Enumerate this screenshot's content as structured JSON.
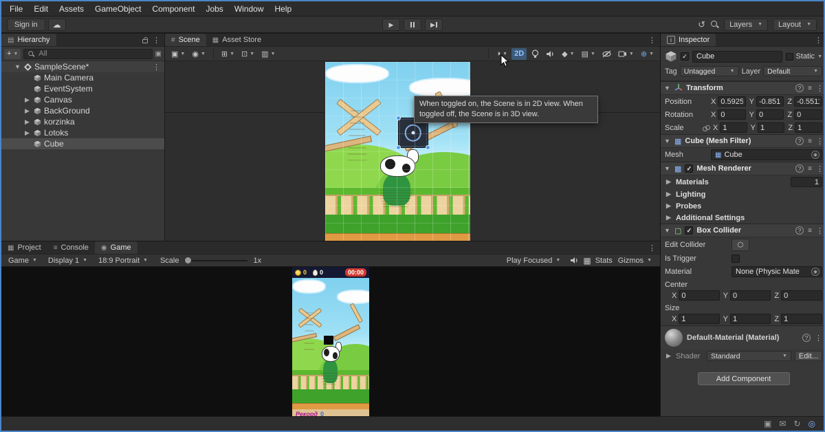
{
  "menu": {
    "items": [
      "File",
      "Edit",
      "Assets",
      "GameObject",
      "Component",
      "Jobs",
      "Window",
      "Help"
    ]
  },
  "toolbar": {
    "sign_in": "Sign in",
    "layers": "Layers",
    "layout": "Layout"
  },
  "hierarchy": {
    "title": "Hierarchy",
    "search_placeholder": "All",
    "scene_item": {
      "label": "SampleScene*"
    },
    "items": [
      {
        "label": "Main Camera"
      },
      {
        "label": "EventSystem"
      },
      {
        "label": "Canvas"
      },
      {
        "label": "BackGround"
      },
      {
        "label": "korzinka"
      },
      {
        "label": "Lotoks"
      },
      {
        "label": "Cube"
      }
    ]
  },
  "scene_panel": {
    "tabs": [
      {
        "label": "Scene"
      },
      {
        "label": "Asset Store"
      }
    ],
    "toggle_2d": "2D",
    "tooltip": {
      "line1": "When toggled on, the Scene is in 2D view. When",
      "line2": "toggled off, the Scene is in 3D view."
    }
  },
  "bottom_panel": {
    "tabs": [
      {
        "label": "Project"
      },
      {
        "label": "Console"
      },
      {
        "label": "Game"
      }
    ],
    "toolbar": {
      "game": "Game",
      "display": "Display 1",
      "aspect": "18:9 Portrait",
      "scale_label": "Scale",
      "scale_value": "1x",
      "play_focused": "Play Focused",
      "stats": "Stats",
      "gizmos": "Gizmos"
    }
  },
  "game_hud": {
    "coins": "0",
    "eggs": "0",
    "timer": "00:00",
    "record_label": "Рекорд",
    "record_value": "0"
  },
  "inspector": {
    "title": "Inspector",
    "axes": {
      "x": "X",
      "y": "Y",
      "z": "Z"
    },
    "object": {
      "name": "Cube",
      "static_label": "Static",
      "tag_label": "Tag",
      "tag_value": "Untagged",
      "layer_label": "Layer",
      "layer_value": "Default"
    },
    "transform": {
      "title": "Transform",
      "rows": [
        {
          "label": "Position",
          "x": "0.5925",
          "y": "-0.851",
          "z": "-0.5511"
        },
        {
          "label": "Rotation",
          "x": "0",
          "y": "0",
          "z": "0"
        },
        {
          "label": "Scale",
          "x": "1",
          "y": "1",
          "z": "1"
        }
      ]
    },
    "mesh_filter": {
      "title": "Cube (Mesh Filter)",
      "mesh_label": "Mesh",
      "mesh_value": "Cube"
    },
    "mesh_renderer": {
      "title": "Mesh Renderer",
      "materials_label": "Materials",
      "materials_count": "1",
      "folds": [
        "Lighting",
        "Probes",
        "Additional Settings"
      ]
    },
    "box_collider": {
      "title": "Box Collider",
      "edit_collider_label": "Edit Collider",
      "is_trigger_label": "Is Trigger",
      "material_label": "Material",
      "material_value": "None (Physic Mate",
      "center_label": "Center",
      "center": {
        "x": "0",
        "y": "0",
        "z": "0"
      },
      "size_label": "Size",
      "size": {
        "x": "1",
        "y": "1",
        "z": "1"
      }
    },
    "material": {
      "title": "Default-Material (Material)",
      "shader_label": "Shader",
      "shader_value": "Standard",
      "edit_label": "Edit..."
    },
    "add_component": "Add Component"
  }
}
